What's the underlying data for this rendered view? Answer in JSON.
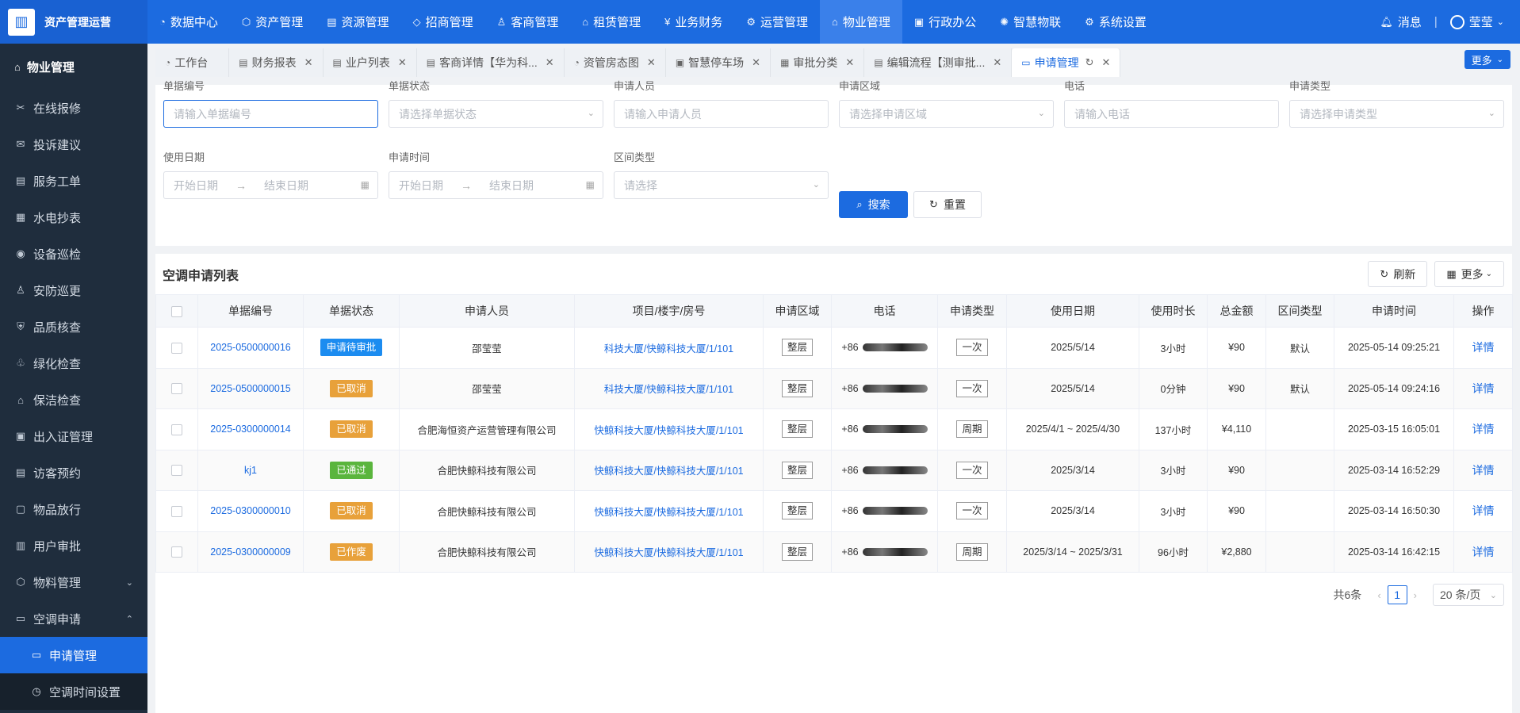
{
  "brand": {
    "title": "资产管理运营"
  },
  "topnav": [
    {
      "label": "数据中心",
      "icon": "◔",
      "name": "data-center"
    },
    {
      "label": "资产管理",
      "icon": "⬡",
      "name": "asset"
    },
    {
      "label": "资源管理",
      "icon": "▤",
      "name": "resource"
    },
    {
      "label": "招商管理",
      "icon": "◇",
      "name": "investment"
    },
    {
      "label": "客商管理",
      "icon": "♙",
      "name": "merchant"
    },
    {
      "label": "租赁管理",
      "icon": "⌂",
      "name": "lease"
    },
    {
      "label": "业务财务",
      "icon": "¥",
      "name": "finance"
    },
    {
      "label": "运营管理",
      "icon": "⚙",
      "name": "operation"
    },
    {
      "label": "物业管理",
      "icon": "⌂",
      "name": "property",
      "active": true
    },
    {
      "label": "行政办公",
      "icon": "▣",
      "name": "office"
    },
    {
      "label": "智慧物联",
      "icon": "✺",
      "name": "iot"
    },
    {
      "label": "系统设置",
      "icon": "⚙",
      "name": "settings"
    }
  ],
  "topright": {
    "messages": "消息",
    "user": "莹莹"
  },
  "sidebar": {
    "head": "物业管理",
    "items": [
      {
        "label": "在线报修",
        "icon": "✂",
        "name": "repair"
      },
      {
        "label": "投诉建议",
        "icon": "✉",
        "name": "complaint"
      },
      {
        "label": "服务工单",
        "icon": "▤",
        "name": "work-order"
      },
      {
        "label": "水电抄表",
        "icon": "▦",
        "name": "meter"
      },
      {
        "label": "设备巡检",
        "icon": "◉",
        "name": "device-inspect"
      },
      {
        "label": "安防巡更",
        "icon": "♙",
        "name": "security"
      },
      {
        "label": "品质核查",
        "icon": "⛨",
        "name": "quality"
      },
      {
        "label": "绿化检查",
        "icon": "♧",
        "name": "greening"
      },
      {
        "label": "保洁检查",
        "icon": "⌂",
        "name": "cleaning"
      },
      {
        "label": "出入证管理",
        "icon": "▣",
        "name": "pass"
      },
      {
        "label": "访客预约",
        "icon": "▤",
        "name": "visitor"
      },
      {
        "label": "物品放行",
        "icon": "▢",
        "name": "goods-release"
      },
      {
        "label": "用户审批",
        "icon": "▥",
        "name": "user-approve"
      },
      {
        "label": "物料管理",
        "icon": "⬡",
        "name": "material",
        "caret": "⌄"
      },
      {
        "label": "空调申请",
        "icon": "▭",
        "name": "ac-apply",
        "caret": "⌃"
      }
    ],
    "subitems": [
      {
        "label": "申请管理",
        "icon": "▭",
        "name": "apply-manage",
        "active": true
      },
      {
        "label": "空调时间设置",
        "icon": "◷",
        "name": "ac-time"
      }
    ]
  },
  "tabs": [
    {
      "label": "工作台",
      "icon": "◔",
      "name": "workbench",
      "closable": false
    },
    {
      "label": "财务报表",
      "icon": "▤",
      "name": "finance-report",
      "closable": true
    },
    {
      "label": "业户列表",
      "icon": "▤",
      "name": "owner-list",
      "closable": true
    },
    {
      "label": "客商详情【华为科...",
      "icon": "▤",
      "name": "merchant-detail",
      "closable": true
    },
    {
      "label": "资管房态图",
      "icon": "◔",
      "name": "room-status",
      "closable": true
    },
    {
      "label": "智慧停车场",
      "icon": "▣",
      "name": "parking",
      "closable": true
    },
    {
      "label": "审批分类",
      "icon": "▦",
      "name": "approve-cat",
      "closable": true
    },
    {
      "label": "编辑流程【测审批...",
      "icon": "▤",
      "name": "edit-flow",
      "closable": true
    },
    {
      "label": "申请管理",
      "icon": "▭",
      "name": "apply",
      "closable": true,
      "active": true
    }
  ],
  "tabs_more": "更多",
  "filters": {
    "doc_no": {
      "label": "单据编号",
      "placeholder": "请输入单据编号"
    },
    "doc_status": {
      "label": "单据状态",
      "placeholder": "请选择单据状态"
    },
    "applicant": {
      "label": "申请人员",
      "placeholder": "请输入申请人员"
    },
    "area": {
      "label": "申请区域",
      "placeholder": "请选择申请区域"
    },
    "phone": {
      "label": "电话",
      "placeholder": "请输入电话"
    },
    "apply_type": {
      "label": "申请类型",
      "placeholder": "请选择申请类型"
    },
    "use_date": {
      "label": "使用日期",
      "start": "开始日期",
      "end": "结束日期"
    },
    "apply_time": {
      "label": "申请时间",
      "start": "开始日期",
      "end": "结束日期"
    },
    "range_type": {
      "label": "区间类型",
      "placeholder": "请选择"
    },
    "search": "搜索",
    "reset": "重置"
  },
  "list": {
    "title": "空调申请列表",
    "refresh": "刷新",
    "more": "更多",
    "columns": [
      "单据编号",
      "单据状态",
      "申请人员",
      "项目/楼宇/房号",
      "申请区域",
      "电话",
      "申请类型",
      "使用日期",
      "使用时长",
      "总金额",
      "区间类型",
      "申请时间",
      "操作"
    ],
    "rows": [
      {
        "no": "2025-0500000016",
        "status": "申请待审批",
        "status_color": "#1c8cf0",
        "applicant": "邵莹莹",
        "project": "科技大厦/快鲸科技大厦/1/101",
        "area": "整层",
        "phone": "+86",
        "type": "一次",
        "date": "2025/5/14",
        "duration": "3小时",
        "amount": "¥90",
        "range": "默认",
        "time": "2025-05-14 09:25:21",
        "op": "详情"
      },
      {
        "no": "2025-0500000015",
        "status": "已取消",
        "status_color": "#e8a13a",
        "applicant": "邵莹莹",
        "project": "科技大厦/快鲸科技大厦/1/101",
        "area": "整层",
        "phone": "+86",
        "type": "一次",
        "date": "2025/5/14",
        "duration": "0分钟",
        "amount": "¥90",
        "range": "默认",
        "time": "2025-05-14 09:24:16",
        "op": "详情"
      },
      {
        "no": "2025-0300000014",
        "status": "已取消",
        "status_color": "#e8a13a",
        "applicant": "合肥海恒资产运营管理有限公司",
        "project": "快鲸科技大厦/快鲸科技大厦/1/101",
        "area": "整层",
        "phone": "+86",
        "type": "周期",
        "date": "2025/4/1 ~ 2025/4/30",
        "duration": "137小时",
        "amount": "¥4,110",
        "range": "",
        "time": "2025-03-15 16:05:01",
        "op": "详情"
      },
      {
        "no": "kj1",
        "status": "已通过",
        "status_color": "#5ab53d",
        "applicant": "合肥快鲸科技有限公司",
        "project": "快鲸科技大厦/快鲸科技大厦/1/101",
        "area": "整层",
        "phone": "+86",
        "type": "一次",
        "date": "2025/3/14",
        "duration": "3小时",
        "amount": "¥90",
        "range": "",
        "time": "2025-03-14 16:52:29",
        "op": "详情"
      },
      {
        "no": "2025-0300000010",
        "status": "已取消",
        "status_color": "#e8a13a",
        "applicant": "合肥快鲸科技有限公司",
        "project": "快鲸科技大厦/快鲸科技大厦/1/101",
        "area": "整层",
        "phone": "+86",
        "type": "一次",
        "date": "2025/3/14",
        "duration": "3小时",
        "amount": "¥90",
        "range": "",
        "time": "2025-03-14 16:50:30",
        "op": "详情"
      },
      {
        "no": "2025-0300000009",
        "status": "已作废",
        "status_color": "#e8a13a",
        "applicant": "合肥快鲸科技有限公司",
        "project": "快鲸科技大厦/快鲸科技大厦/1/101",
        "area": "整层",
        "phone": "+86",
        "type": "周期",
        "date": "2025/3/14 ~ 2025/3/31",
        "duration": "96小时",
        "amount": "¥2,880",
        "range": "",
        "time": "2025-03-14 16:42:15",
        "op": "详情"
      }
    ]
  },
  "pager": {
    "total": "共6条",
    "page": "1",
    "size": "20 条/页"
  }
}
